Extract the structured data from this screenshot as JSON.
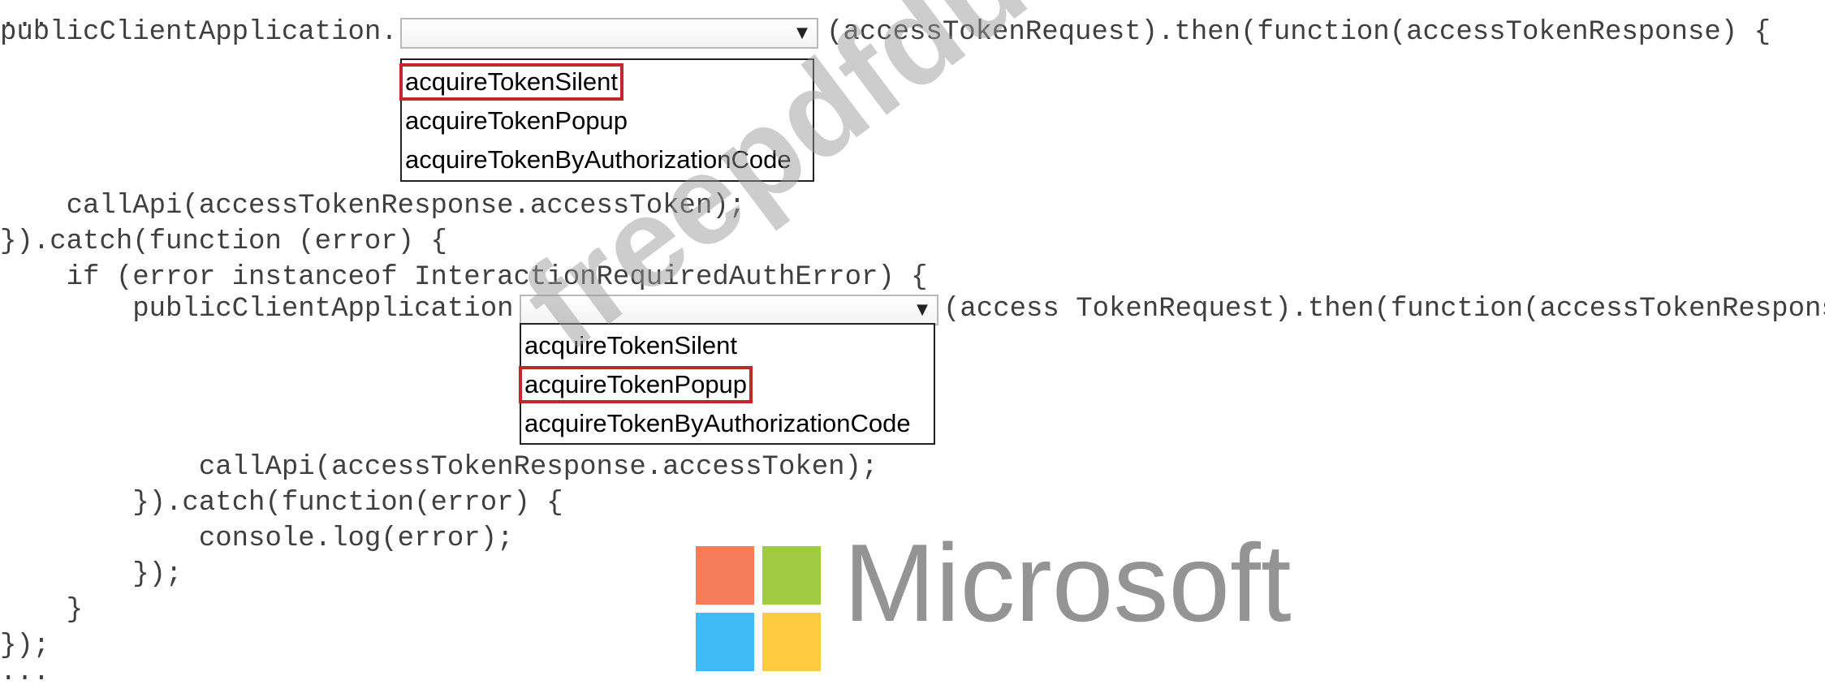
{
  "code": {
    "line1": "...",
    "line2_prefix": "publicClientApplication.",
    "line2_suffix": "(accessTokenRequest).then(function(accessTokenResponse) {",
    "line3": "    callApi(accessTokenResponse.accessToken);",
    "line4": "}).catch(function (error) {",
    "line5": "    if (error instanceof InteractionRequiredAuthError) {",
    "line6_prefix": "        publicClientApplication.",
    "line6_suffix": "(access TokenRequest).then(function(accessTokenResponse) {",
    "line7": "            callApi(accessTokenResponse.accessToken);",
    "line8": "        }).catch(function(error) {",
    "line9": "            console.log(error);",
    "line10": "        });",
    "line11": "    }",
    "line12": "});",
    "line13": "..."
  },
  "dropdowns": [
    {
      "selected": "acquireTokenSilent",
      "options": [
        "acquireTokenSilent",
        "acquireTokenPopup",
        "acquireTokenByAuthorizationCode"
      ]
    },
    {
      "selected": "acquireTokenPopup",
      "options": [
        "acquireTokenSilent",
        "acquireTokenPopup",
        "acquireTokenByAuthorizationCode"
      ]
    }
  ],
  "icons": {
    "dropdown_arrow": "chevron-down-icon",
    "logo": "microsoft-logo"
  },
  "colors": {
    "selection_border": "#c1272d",
    "logo_red": "#f25022",
    "logo_green": "#7fba00",
    "logo_blue": "#00a4ef",
    "logo_yellow": "#ffb900"
  },
  "watermark": {
    "text": "freepdfdumps.com"
  },
  "logo": {
    "text": "Microsoft"
  }
}
